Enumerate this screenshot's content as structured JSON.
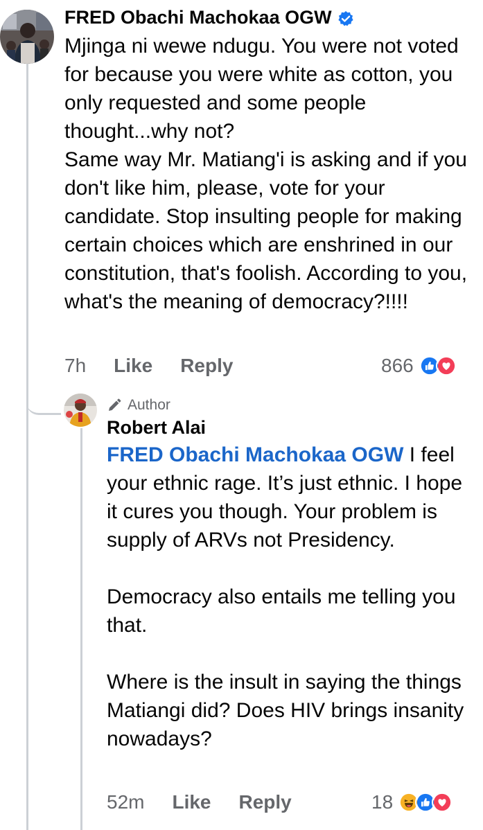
{
  "comment": {
    "author": "FRED Obachi Machokaa OGW",
    "text": "Mjinga ni wewe ndugu. You were not voted for because you were white as cotton, you only requested and some people thought...why not?\nSame way Mr. Matiang'i is asking and if you don't like him, please, vote for your candidate. Stop insulting people for making certain choices which are enshrined in our constitution, that's foolish. According to you, what's the meaning of democracy?!!!!",
    "time": "7h",
    "like_label": "Like",
    "reply_label": "Reply",
    "reaction_count": "866",
    "reactions": [
      "like-icon",
      "love-icon"
    ]
  },
  "reply": {
    "badge": "Author",
    "author": "Robert Alai",
    "mention": "FRED Obachi Machokaa OGW",
    "text": " I feel your ethnic rage. It’s just ethnic. I hope it cures you though. Your problem is supply of ARVs not Presidency.\n\nDemocracy also entails me telling you that.\n\nWhere is the insult in saying the things Matiangi did? Does HIV brings insanity nowadays?",
    "time": "52m",
    "like_label": "Like",
    "reply_label": "Reply",
    "reaction_count": "18",
    "reactions": [
      "haha-icon",
      "like-icon",
      "love-icon"
    ]
  },
  "colors": {
    "mention": "#1b66c9",
    "like": "#1877f2",
    "love": "#f33e58",
    "haha": "#f7b125",
    "thread_line": "#ccd0d5",
    "meta": "#65676b"
  }
}
